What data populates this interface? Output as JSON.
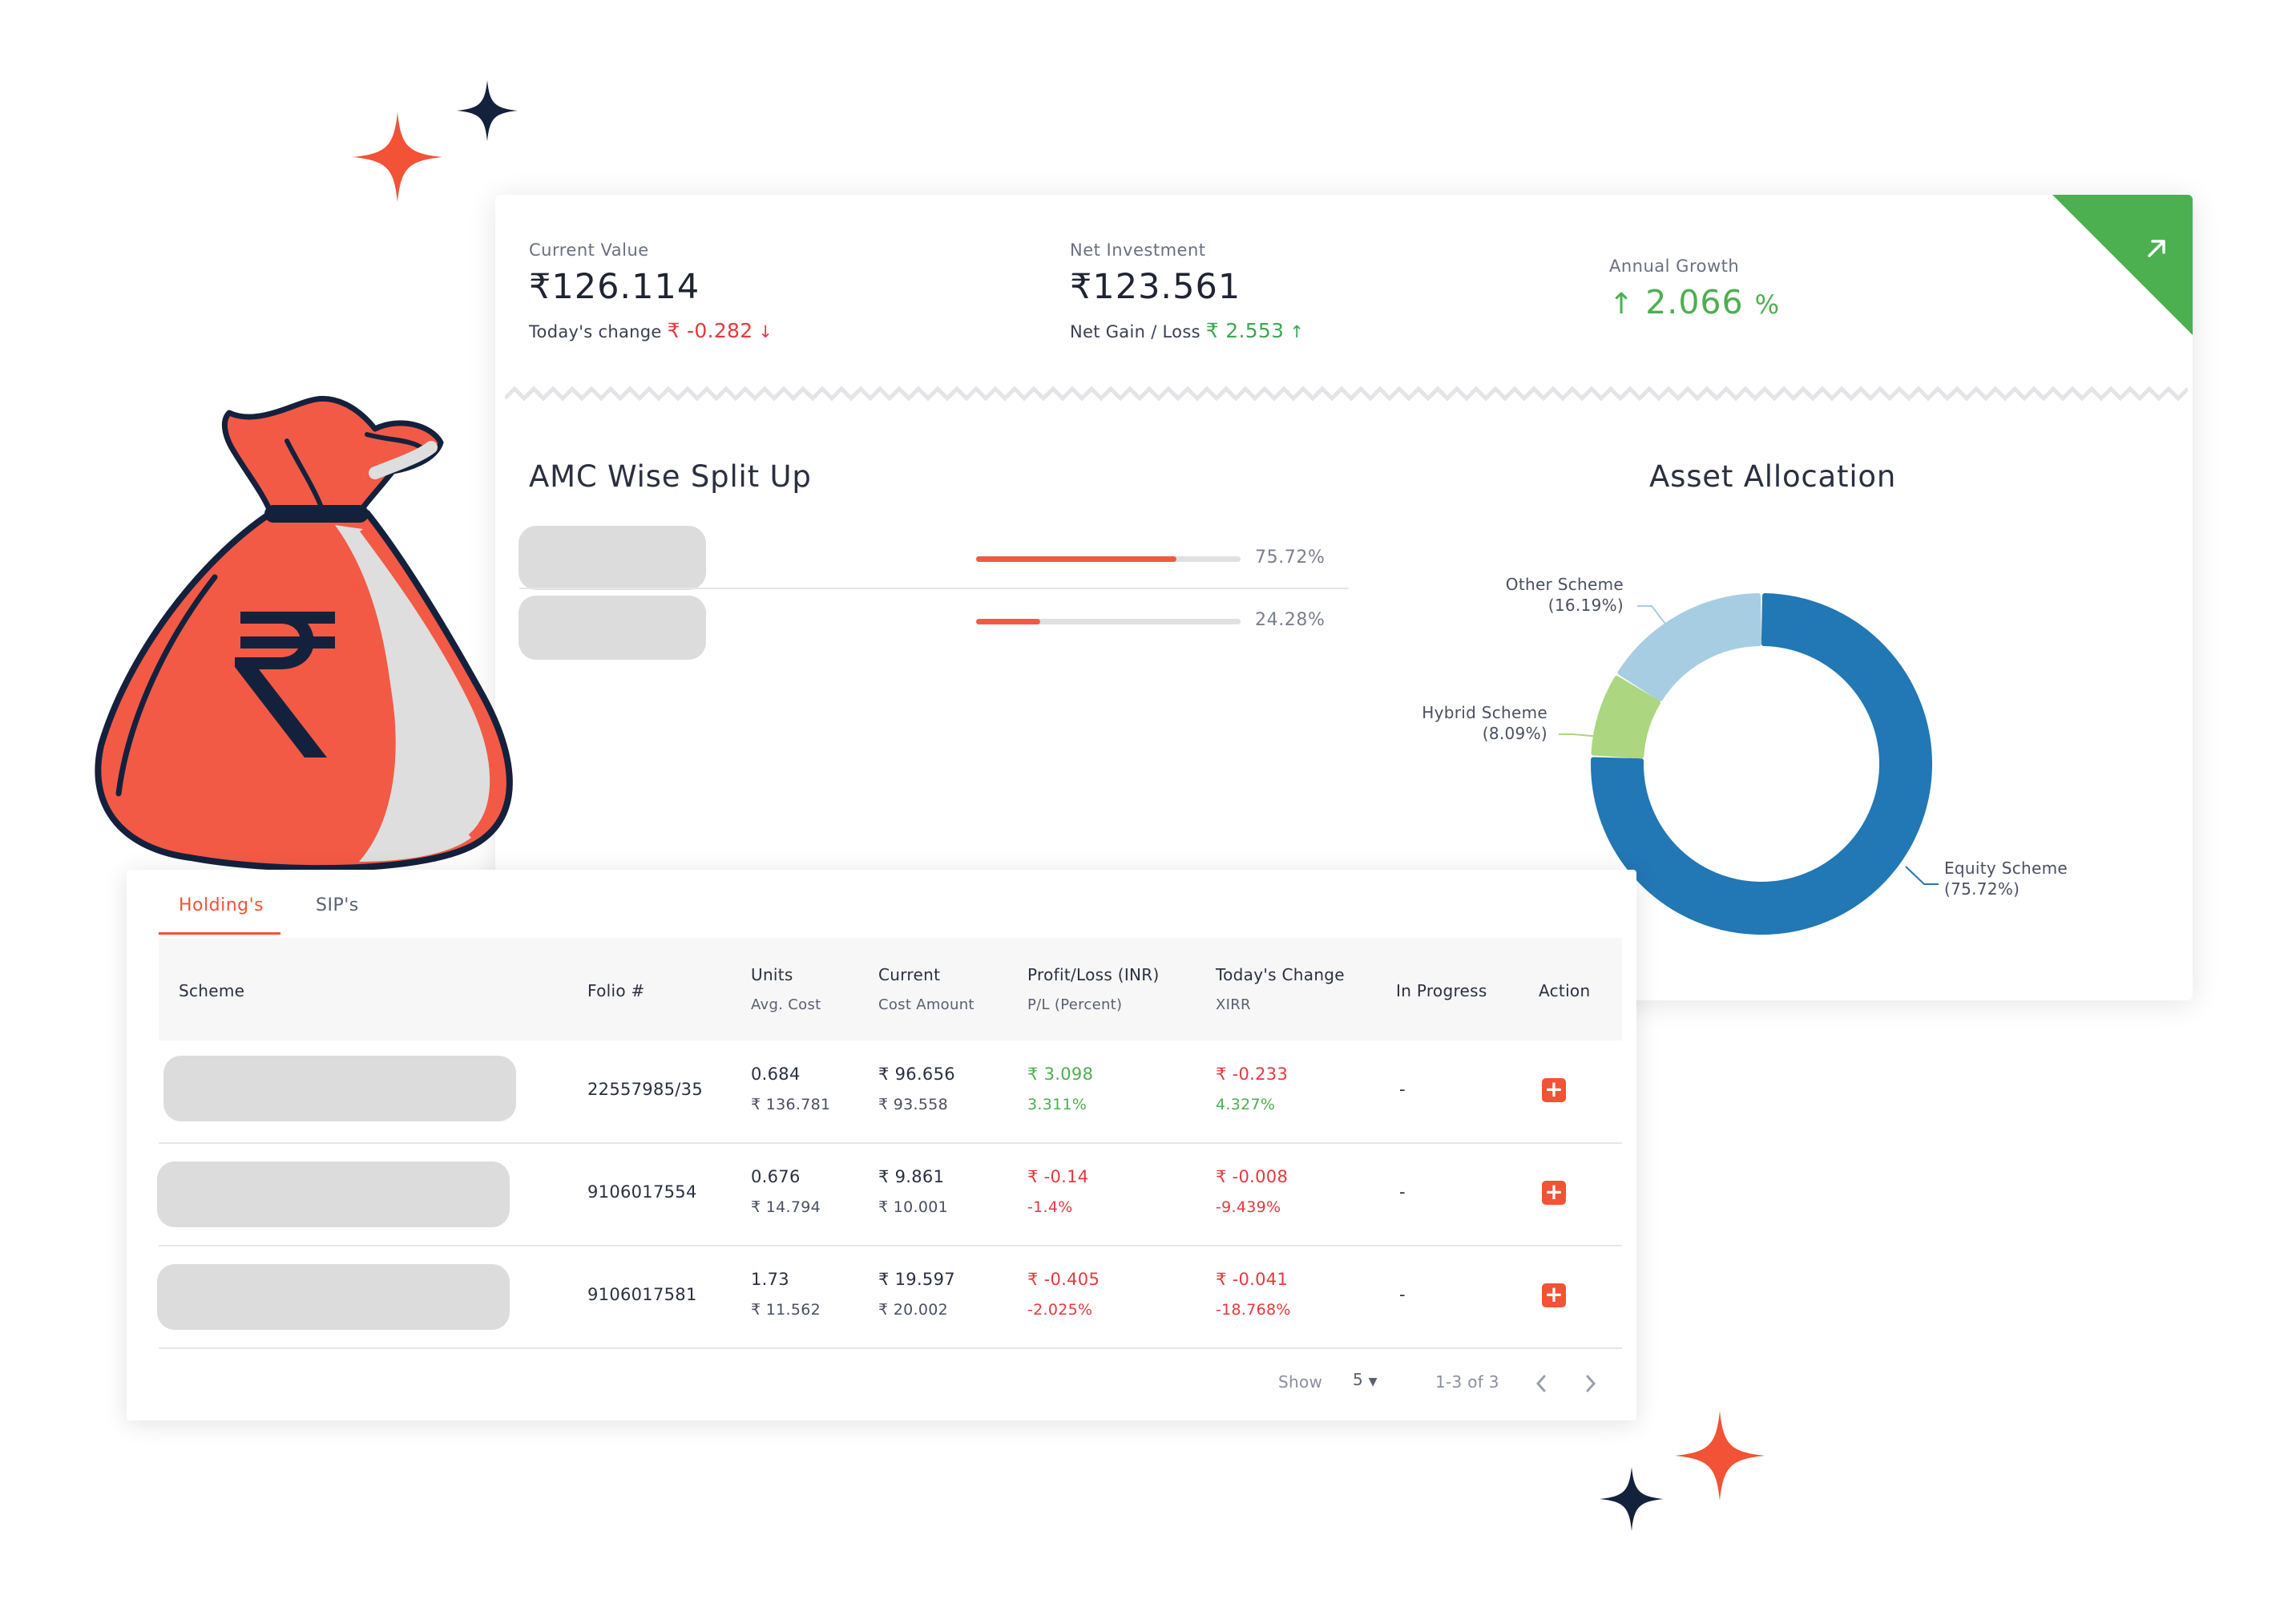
{
  "summary": {
    "current_value": {
      "label": "Current Value",
      "value": "₹126.114",
      "change_label": "Today's change",
      "change_value": "₹ -0.282"
    },
    "net_investment": {
      "label": "Net Investment",
      "value": "₹123.561",
      "gain_label": "Net Gain / Loss",
      "gain_value": "₹ 2.553"
    },
    "annual_growth": {
      "label": "Annual Growth",
      "value": "2.066",
      "unit": "%"
    }
  },
  "amc_split": {
    "title": "AMC Wise Split Up",
    "items": [
      {
        "percent_label": "75.72%",
        "fraction": 0.7572
      },
      {
        "percent_label": "24.28%",
        "fraction": 0.2428
      }
    ]
  },
  "asset_allocation": {
    "title": "Asset Allocation",
    "labels": {
      "other_name": "Other Scheme",
      "other_pct": "(16.19%)",
      "hybrid_name": "Hybrid Scheme",
      "hybrid_pct": "(8.09%)",
      "equity_name": "Equity Scheme",
      "equity_pct": "(75.72%)"
    }
  },
  "chart_data": {
    "type": "pie",
    "categories": [
      "Equity Scheme",
      "Hybrid Scheme",
      "Other Scheme"
    ],
    "values": [
      75.72,
      8.09,
      16.19
    ],
    "colors": [
      "#2277b5",
      "#acd67f",
      "#a7cde3"
    ],
    "title": "Asset Allocation"
  },
  "tabs": [
    {
      "label": "Holding's",
      "active": true
    },
    {
      "label": "SIP's",
      "active": false
    }
  ],
  "table": {
    "headers": {
      "scheme": "Scheme",
      "folio": "Folio #",
      "units": "Units",
      "avg_cost": "Avg. Cost",
      "current": "Current",
      "cost_amount": "Cost Amount",
      "pl_inr": "Profit/Loss (INR)",
      "pl_pct": "P/L (Percent)",
      "todays_change": "Today's Change",
      "xirr": "XIRR",
      "in_progress": "In Progress",
      "action": "Action"
    },
    "rows": [
      {
        "folio": "22557985/35",
        "units": "0.684",
        "avg_cost": "₹ 136.781",
        "current": "₹ 96.656",
        "cost_amount": "₹ 93.558",
        "pl": "₹ 3.098",
        "pl_pct": "3.311%",
        "change": "₹ -0.233",
        "xirr": "4.327%",
        "in_progress": "-"
      },
      {
        "folio": "9106017554",
        "units": "0.676",
        "avg_cost": "₹ 14.794",
        "current": "₹ 9.861",
        "cost_amount": "₹ 10.001",
        "pl": "₹ -0.14",
        "pl_pct": "-1.4%",
        "change": "₹ -0.008",
        "xirr": "-9.439%",
        "in_progress": "-"
      },
      {
        "folio": "9106017581",
        "units": "1.73",
        "avg_cost": "₹ 11.562",
        "current": "₹ 19.597",
        "cost_amount": "₹ 20.002",
        "pl": "₹ -0.405",
        "pl_pct": "-2.025%",
        "change": "₹ -0.041",
        "xirr": "-18.768%",
        "in_progress": "-"
      }
    ]
  },
  "pagination": {
    "show_label": "Show",
    "page_size": "5",
    "range": "1-3 of 3"
  },
  "colors": {
    "accent": "#f25235",
    "positive": "#4caf50",
    "negative": "#e8373d",
    "navy": "#14213d"
  }
}
